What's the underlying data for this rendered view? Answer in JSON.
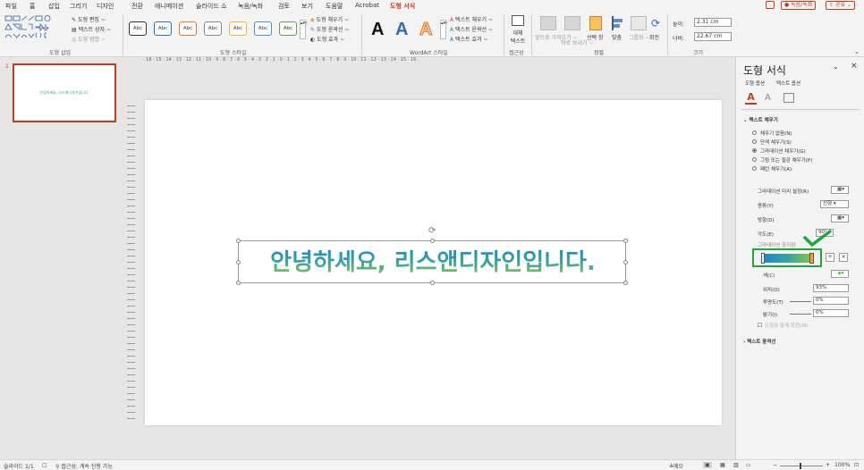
{
  "menu": [
    "파일",
    "홈",
    "삽입",
    "그리기",
    "디자인",
    "전환",
    "애니메이션",
    "슬라이드 쇼",
    "녹음/녹화",
    "검토",
    "보기",
    "도움말",
    "Acrobat",
    "도형 서식"
  ],
  "topright": {
    "comment": "",
    "record": "● 녹음/녹화",
    "share": "공유"
  },
  "ribbon": {
    "insert_shapes": {
      "edit": "도형 편집 ~",
      "textbox": "텍스트 상자 ~",
      "merge": "도형 병합 ~",
      "label": "도형 삽입"
    },
    "shape_styles": {
      "samples": [
        "Abc",
        "Abc",
        "Abc",
        "Abc",
        "Abc",
        "Abc",
        "Abc"
      ],
      "fill": "도형 채우기 ~",
      "outline": "도형 윤곽선 ~",
      "effects": "도형 효과 ~",
      "label": "도형 스타일"
    },
    "wordart": {
      "letter": "A",
      "fill": "텍스트 채우기 ~",
      "outline": "텍스트 윤곽선 ~",
      "effects": "텍스트 효과 ~",
      "label": "WordArt 스타일"
    },
    "accessibility": {
      "alt1": "대체",
      "alt2": "텍스트",
      "label": "접근성"
    },
    "arrange": {
      "forward": "앞으로 가져오기 ~",
      "backward": "뒤로 보내기 ~",
      "selection": "선택 창",
      "align": "맞춤",
      "group": "그룹화 ~",
      "rotate": "회전",
      "label": "정렬"
    },
    "size": {
      "height_label": "높이:",
      "height": "2.31 cm",
      "width_label": "너비:",
      "width": "22.67 cm",
      "label": "크기"
    }
  },
  "thumb": {
    "number": "1",
    "text": "안녕하세요, 리스앤디자인입니다."
  },
  "ruler_h": "· 16 · 15 · 14 · 13 · 12 · 11 · 10 · 9 · 8 · 7 · 6 · 5 · 4 · 3 · 2 · 1 · 0 · 1 · 2 · 3 · 4 · 5 · 6 · 7 · 8 · 9 · 10 · 11 · 12 · 13 · 14 · 15 · 16 ·",
  "slide_text": "안녕하세요, 리스앤디자인입니다.",
  "pane": {
    "title": "도형 서식",
    "tab_shape": "도형 옵션",
    "tab_text": "텍스트 옵션",
    "section_fill": "텍스트 채우기",
    "options": [
      "채우기 없음(N)",
      "단색 채우기(S)",
      "그라데이션 채우기(G)",
      "그림 또는 질감 채우기(P)",
      "패턴 채우기(A)"
    ],
    "preset_label": "그라데이션 미리 설정(R)",
    "type_label": "종류(Y)",
    "type_value": "선형",
    "direction_label": "방향(D)",
    "angle_label": "각도(E)",
    "angle_value": "90°",
    "stops_label": "그라데이션 중지점",
    "color_label": "색(C)",
    "position_label": "위치(O)",
    "position_value": "93%",
    "transparency_label": "투명도(T)",
    "transparency_value": "0%",
    "brightness_label": "밝기(I)",
    "brightness_value": "0%",
    "rotate_label": "도형과 함께 회전(W)",
    "section_outline": "텍스트 윤곽선"
  },
  "status": {
    "slide": "슬라이드 1/1",
    "access": "접근성: 계속 진행 가능",
    "notes": "메모",
    "zoom": "100%"
  },
  "colors": {
    "accent": "#c43e1c",
    "green_highlight": "#1fa83a",
    "gradient_start": "#1e88c8",
    "gradient_end": "#8bc34a"
  }
}
